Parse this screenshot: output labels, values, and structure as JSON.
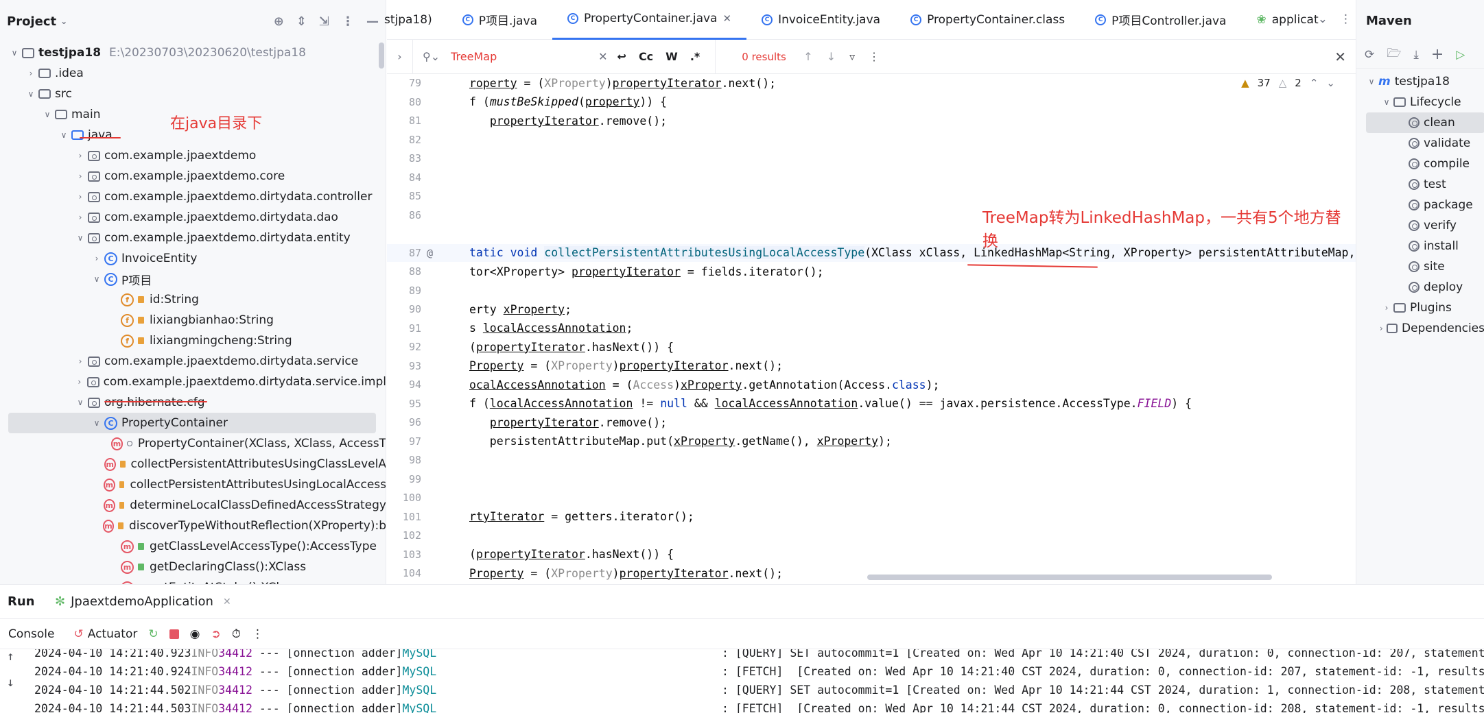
{
  "project": {
    "title": "Project",
    "tree": [
      {
        "label": "testjpa18",
        "path": "E:\\20230703\\20230620\\testjpa18",
        "icon": "project-module-icon",
        "level": 0,
        "open": true
      },
      {
        "label": ".idea",
        "icon": "folder-icon",
        "level": 1,
        "open": false
      },
      {
        "label": "src",
        "icon": "folder-icon",
        "level": 1,
        "open": true
      },
      {
        "label": "main",
        "icon": "folder-icon",
        "level": 2,
        "open": true
      },
      {
        "label": "java",
        "icon": "source-folder-icon",
        "level": 3,
        "open": true
      },
      {
        "label": "com.example.jpaextdemo",
        "icon": "package-icon",
        "level": 4,
        "open": false
      },
      {
        "label": "com.example.jpaextdemo.core",
        "icon": "package-icon",
        "level": 4,
        "open": false
      },
      {
        "label": "com.example.jpaextdemo.dirtydata.controller",
        "icon": "package-icon",
        "level": 4,
        "open": false
      },
      {
        "label": "com.example.jpaextdemo.dirtydata.dao",
        "icon": "package-icon",
        "level": 4,
        "open": false
      },
      {
        "label": "com.example.jpaextdemo.dirtydata.entity",
        "icon": "package-icon",
        "level": 4,
        "open": true
      },
      {
        "label": "InvoiceEntity",
        "icon": "class-icon",
        "level": 5,
        "open": false
      },
      {
        "label": "P项目",
        "icon": "class-icon",
        "level": 5,
        "open": true
      },
      {
        "label": "id:String",
        "icon": "field-icon",
        "level": 6,
        "leaf": true
      },
      {
        "label": "lixiangbianhao:String",
        "icon": "field-icon",
        "level": 6,
        "leaf": true
      },
      {
        "label": "lixiangmingcheng:String",
        "icon": "field-icon",
        "level": 6,
        "leaf": true
      },
      {
        "label": "com.example.jpaextdemo.dirtydata.service",
        "icon": "package-icon",
        "level": 4,
        "open": false
      },
      {
        "label": "com.example.jpaextdemo.dirtydata.service.impl",
        "icon": "package-icon",
        "level": 4,
        "open": false
      },
      {
        "label": "org.hibernate.cfg",
        "icon": "package-icon",
        "level": 4,
        "open": true
      },
      {
        "label": "PropertyContainer",
        "icon": "class-icon",
        "level": 5,
        "open": true,
        "selected": true
      },
      {
        "label": "PropertyContainer(XClass, XClass, AccessT",
        "icon": "method-icon",
        "level": 6,
        "leaf": true,
        "mod": "dot"
      },
      {
        "label": "collectPersistentAttributesUsingClassLevelA",
        "icon": "method-icon",
        "level": 6,
        "leaf": true,
        "mod": "lock"
      },
      {
        "label": "collectPersistentAttributesUsingLocalAccess",
        "icon": "method-icon",
        "level": 6,
        "leaf": true,
        "mod": "lock"
      },
      {
        "label": "determineLocalClassDefinedAccessStrategy",
        "icon": "method-icon",
        "level": 6,
        "leaf": true,
        "mod": "lock"
      },
      {
        "label": "discoverTypeWithoutReflection(XProperty):b",
        "icon": "method-icon",
        "level": 6,
        "leaf": true,
        "mod": "lock"
      },
      {
        "label": "getClassLevelAccessType():AccessType",
        "icon": "method-icon",
        "level": 6,
        "leaf": true,
        "mod": "green"
      },
      {
        "label": "getDeclaringClass():XClass",
        "icon": "method-icon",
        "level": 6,
        "leaf": true,
        "mod": "green"
      },
      {
        "label": "getEntityAtStake():XClass",
        "icon": "method-icon",
        "level": 6,
        "leaf": true,
        "mod": "green"
      }
    ],
    "annotation": "在java目录下"
  },
  "editor": {
    "tabs": [
      {
        "label": "stjpa18)",
        "icon": ""
      },
      {
        "label": "P项目.java",
        "icon": "class-icon"
      },
      {
        "label": "PropertyContainer.java",
        "icon": "class-icon",
        "active": true,
        "closable": true
      },
      {
        "label": "InvoiceEntity.java",
        "icon": "class-icon"
      },
      {
        "label": "PropertyContainer.class",
        "icon": "class-icon"
      },
      {
        "label": "P项目Controller.java",
        "icon": "class-icon"
      },
      {
        "label": "applicat",
        "icon": "spring-icon"
      }
    ],
    "find": {
      "query": "TreeMap",
      "results": "0 results",
      "opt_case": "Cc",
      "opt_word": "W",
      "opt_regex": ".*"
    },
    "inspections": {
      "warnings": "37",
      "weak": "2"
    },
    "annotation": "TreeMap转为LinkedHashMap，一共有5个地方替换",
    "lines": [
      {
        "n": "79",
        "segs": [
          [
            "roperty",
            "ul"
          ],
          [
            " = (",
            ""
          ],
          [
            "XProperty",
            "gray"
          ],
          [
            ")",
            ""
          ],
          [
            "propertyIterator",
            "ul"
          ],
          [
            ".next();",
            ""
          ]
        ]
      },
      {
        "n": "80",
        "segs": [
          [
            "f (",
            ""
          ],
          [
            "mustBeSkipped",
            "it"
          ],
          [
            "(",
            ""
          ],
          [
            "property",
            "ul"
          ],
          [
            ")) {",
            ""
          ]
        ]
      },
      {
        "n": "81",
        "segs": [
          [
            "   ",
            ""
          ],
          [
            "propertyIterator",
            "ul"
          ],
          [
            ".remove();",
            ""
          ]
        ]
      },
      {
        "n": "82",
        "segs": []
      },
      {
        "n": "83",
        "segs": []
      },
      {
        "n": "84",
        "segs": []
      },
      {
        "n": "85",
        "segs": []
      },
      {
        "n": "86",
        "segs": []
      },
      {
        "n": "",
        "segs": []
      },
      {
        "n": "87",
        "gutter": "@",
        "cur": true,
        "segs": [
          [
            "tatic void ",
            "kw"
          ],
          [
            "collectPersistentAttributesUsingLocalAccessType",
            "hl"
          ],
          [
            "(XClass xClass, LinkedHashMap<String, XProperty> persistentAttributeMap,",
            ""
          ]
        ]
      },
      {
        "n": "88",
        "segs": [
          [
            "tor<XProperty> ",
            ""
          ],
          [
            "propertyIterator",
            "ul"
          ],
          [
            " = fields.iterator();",
            ""
          ]
        ]
      },
      {
        "n": "89",
        "segs": []
      },
      {
        "n": "90",
        "segs": [
          [
            "erty ",
            ""
          ],
          [
            "xProperty",
            "ul"
          ],
          [
            ";",
            ""
          ]
        ]
      },
      {
        "n": "91",
        "segs": [
          [
            "s ",
            ""
          ],
          [
            "localAccessAnnotation",
            "ul"
          ],
          [
            ";",
            ""
          ]
        ]
      },
      {
        "n": "92",
        "segs": [
          [
            "(",
            ""
          ],
          [
            "propertyIterator",
            "ul"
          ],
          [
            ".hasNext()) {",
            ""
          ]
        ]
      },
      {
        "n": "93",
        "segs": [
          [
            "Property",
            "ul"
          ],
          [
            " = (",
            ""
          ],
          [
            "XProperty",
            "gray"
          ],
          [
            ")",
            ""
          ],
          [
            "propertyIterator",
            "ul"
          ],
          [
            ".next();",
            ""
          ]
        ]
      },
      {
        "n": "94",
        "segs": [
          [
            "ocalAccessAnnotation",
            "ul"
          ],
          [
            " = (",
            ""
          ],
          [
            "Access",
            "gray"
          ],
          [
            ")",
            ""
          ],
          [
            "xProperty",
            "ul"
          ],
          [
            ".getAnnotation(Access.",
            ""
          ],
          [
            "class",
            "kw"
          ],
          [
            ");",
            ""
          ]
        ]
      },
      {
        "n": "95",
        "segs": [
          [
            "f (",
            ""
          ],
          [
            "localAccessAnnotation",
            "ul"
          ],
          [
            " != ",
            ""
          ],
          [
            "null",
            "kw"
          ],
          [
            " && ",
            ""
          ],
          [
            "localAccessAnnotation",
            "ul"
          ],
          [
            ".value() == javax.persistence.AccessType.",
            ""
          ],
          [
            "FIELD",
            "purp"
          ],
          [
            ") {",
            ""
          ]
        ]
      },
      {
        "n": "96",
        "segs": [
          [
            "   ",
            ""
          ],
          [
            "propertyIterator",
            "ul"
          ],
          [
            ".remove();",
            ""
          ]
        ]
      },
      {
        "n": "97",
        "segs": [
          [
            "   persistentAttributeMap.put(",
            ""
          ],
          [
            "xProperty",
            "ul"
          ],
          [
            ".getName(), ",
            ""
          ],
          [
            "xProperty",
            "ul"
          ],
          [
            ");",
            ""
          ]
        ]
      },
      {
        "n": "98",
        "segs": []
      },
      {
        "n": "99",
        "segs": []
      },
      {
        "n": "100",
        "segs": []
      },
      {
        "n": "101",
        "segs": [
          [
            "rtyIterator",
            "ul"
          ],
          [
            " = getters.iterator();",
            ""
          ]
        ]
      },
      {
        "n": "102",
        "segs": []
      },
      {
        "n": "103",
        "segs": [
          [
            "(",
            ""
          ],
          [
            "propertyIterator",
            "ul"
          ],
          [
            ".hasNext()) {",
            ""
          ]
        ]
      },
      {
        "n": "104",
        "segs": [
          [
            "Property",
            "ul"
          ],
          [
            " = (",
            ""
          ],
          [
            "XProperty",
            "gray"
          ],
          [
            ")",
            ""
          ],
          [
            "propertyIterator",
            "ul"
          ],
          [
            ".next();",
            ""
          ]
        ]
      }
    ]
  },
  "maven": {
    "title": "Maven",
    "tree": [
      {
        "label": "testjpa18",
        "level": 0,
        "open": true,
        "icon": "maven-icon"
      },
      {
        "label": "Lifecycle",
        "level": 1,
        "open": true,
        "icon": "folder-icon"
      },
      {
        "label": "clean",
        "level": 2,
        "icon": "gear-icon",
        "selected": true
      },
      {
        "label": "validate",
        "level": 2,
        "icon": "gear-icon"
      },
      {
        "label": "compile",
        "level": 2,
        "icon": "gear-icon"
      },
      {
        "label": "test",
        "level": 2,
        "icon": "gear-icon"
      },
      {
        "label": "package",
        "level": 2,
        "icon": "gear-icon"
      },
      {
        "label": "verify",
        "level": 2,
        "icon": "gear-icon"
      },
      {
        "label": "install",
        "level": 2,
        "icon": "gear-icon"
      },
      {
        "label": "site",
        "level": 2,
        "icon": "gear-icon"
      },
      {
        "label": "deploy",
        "level": 2,
        "icon": "gear-icon"
      },
      {
        "label": "Plugins",
        "level": 1,
        "open": false,
        "icon": "folder-icon"
      },
      {
        "label": "Dependencies",
        "level": 1,
        "open": false,
        "icon": "folder-icon"
      }
    ]
  },
  "run": {
    "tab_run": "Run",
    "tab_app": "JpaextdemoApplication",
    "console": "Console",
    "actuator": "Actuator",
    "logs": [
      {
        "time": "2024-04-10 14:21:40.923",
        "level": "INFO",
        "pid": "34412",
        "sep": " --- ",
        "thread": "[onnection adder]",
        "src": "MySQL",
        "msg": ": [QUERY] SET autocommit=1 [Created on: Wed Apr 10 14:21:40 CST 2024, duration: 0, connection-id: 207, statement"
      },
      {
        "time": "2024-04-10 14:21:40.924",
        "level": "INFO",
        "pid": "34412",
        "sep": " --- ",
        "thread": "[onnection adder]",
        "src": "MySQL",
        "msg": ": [FETCH]  [Created on: Wed Apr 10 14:21:40 CST 2024, duration: 0, connection-id: 207, statement-id: -1, results"
      },
      {
        "time": "2024-04-10 14:21:44.502",
        "level": "INFO",
        "pid": "34412",
        "sep": " --- ",
        "thread": "[onnection adder]",
        "src": "MySQL",
        "msg": ": [QUERY] SET autocommit=1 [Created on: Wed Apr 10 14:21:44 CST 2024, duration: 1, connection-id: 208, statement"
      },
      {
        "time": "2024-04-10 14:21:44.503",
        "level": "INFO",
        "pid": "34412",
        "sep": " --- ",
        "thread": "[onnection adder]",
        "src": "MySQL",
        "msg": ": [FETCH]  [Created on: Wed Apr 10 14:21:44 CST 2024, duration: 0, connection-id: 208, statement-id: -1, results"
      }
    ]
  },
  "colors": {
    "accent": "#3574f0",
    "annotation": "#e53935",
    "selection": "#dfe1e5"
  }
}
